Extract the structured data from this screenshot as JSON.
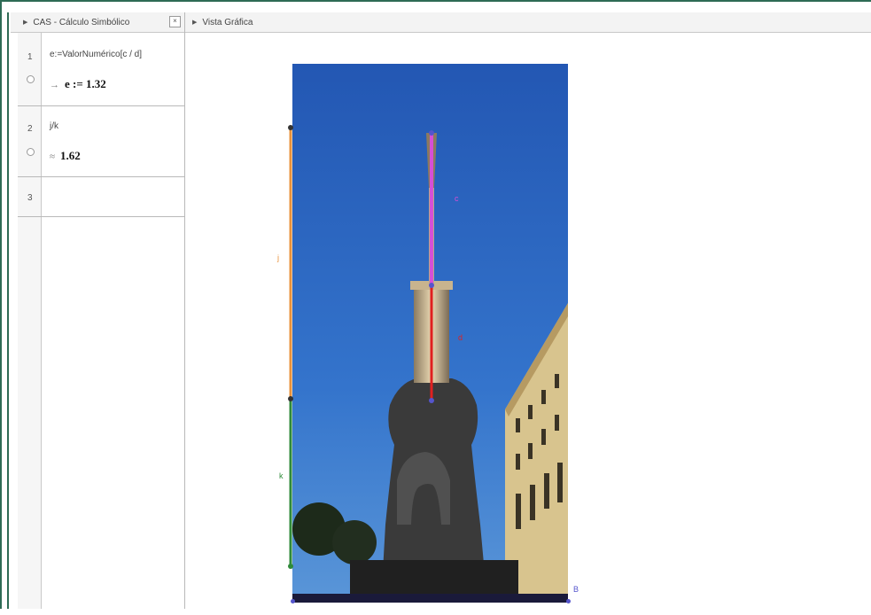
{
  "cas": {
    "title": "CAS - Cálculo Simbólico",
    "close_label": "×",
    "rows": [
      {
        "num": "1",
        "input": "e:=ValorNumérico[c / d]",
        "output_arrow": "→",
        "output": "e := 1.32"
      },
      {
        "num": "2",
        "input": "j/k",
        "output_arrow": "≈",
        "output": "1.62"
      },
      {
        "num": "3",
        "input": "",
        "output_arrow": "",
        "output": ""
      }
    ]
  },
  "graphics": {
    "title": "Vista Gráfica",
    "labels": {
      "j": "j",
      "k": "k",
      "c": "c",
      "d": "d",
      "B": "B"
    }
  },
  "colors": {
    "border": "#2e6b55",
    "segment_j": "#e8913a",
    "segment_k": "#2f8a3a",
    "segment_c": "#d64fd6",
    "segment_d": "#e02020",
    "sky": "#2a5fb8"
  }
}
